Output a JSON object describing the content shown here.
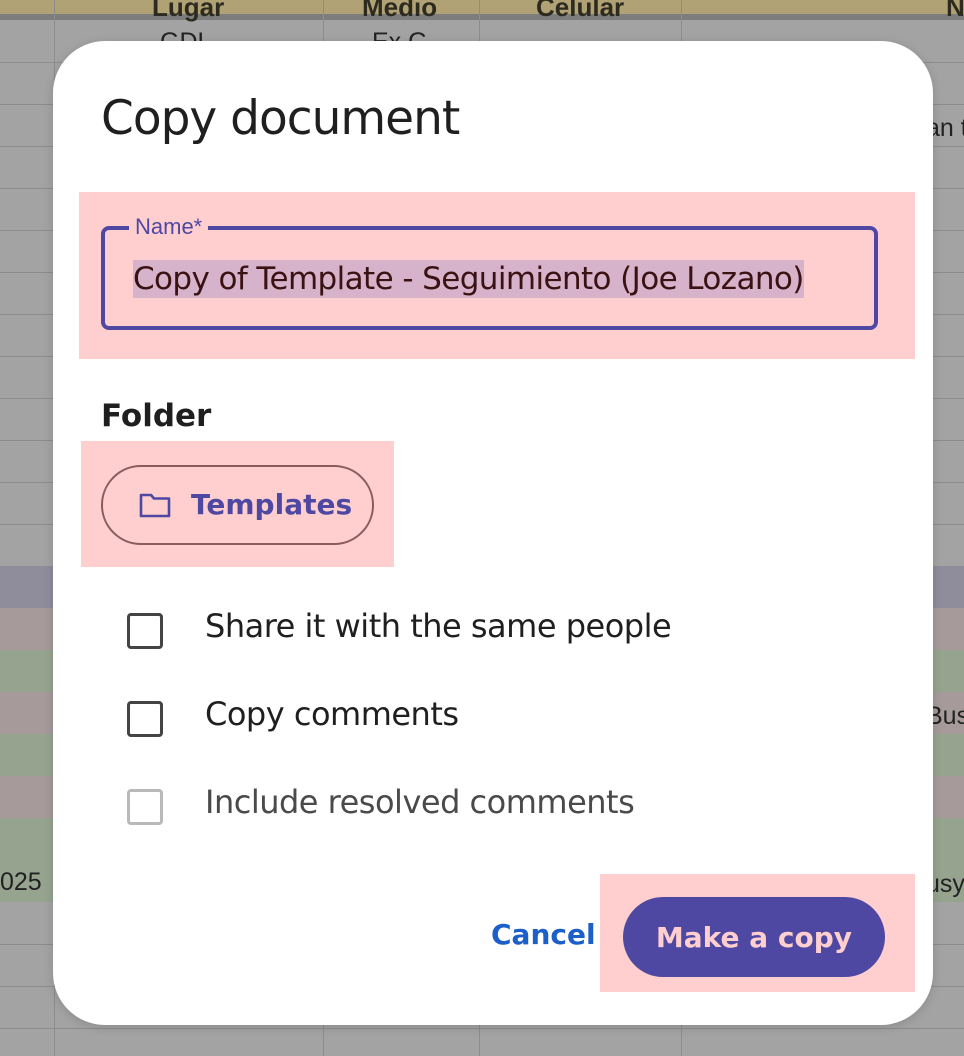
{
  "background": {
    "header_cells": [
      "Lugar",
      "Medio",
      "Celular",
      "N"
    ],
    "cells": [
      "GDL",
      "Ex G",
      "an t",
      "Bus",
      "025",
      "usy"
    ]
  },
  "dialog": {
    "title": "Copy document",
    "name_field": {
      "label": "Name*",
      "value": "Copy of Template - Seguimiento (Joe Lozano)"
    },
    "folder": {
      "heading": "Folder",
      "chip_label": "Templates",
      "icon": "folder-icon"
    },
    "options": [
      {
        "label": "Share it with the same people",
        "checked": false,
        "enabled": true
      },
      {
        "label": "Copy comments",
        "checked": false,
        "enabled": true
      },
      {
        "label": "Include resolved comments",
        "checked": false,
        "enabled": false
      }
    ],
    "cancel_label": "Cancel",
    "make_copy_label": "Make a copy"
  },
  "colors": {
    "accent": "#4e48a3",
    "highlight": "#ffcfcf",
    "link": "#1d5fc9",
    "selection": "#d6b3cb"
  }
}
